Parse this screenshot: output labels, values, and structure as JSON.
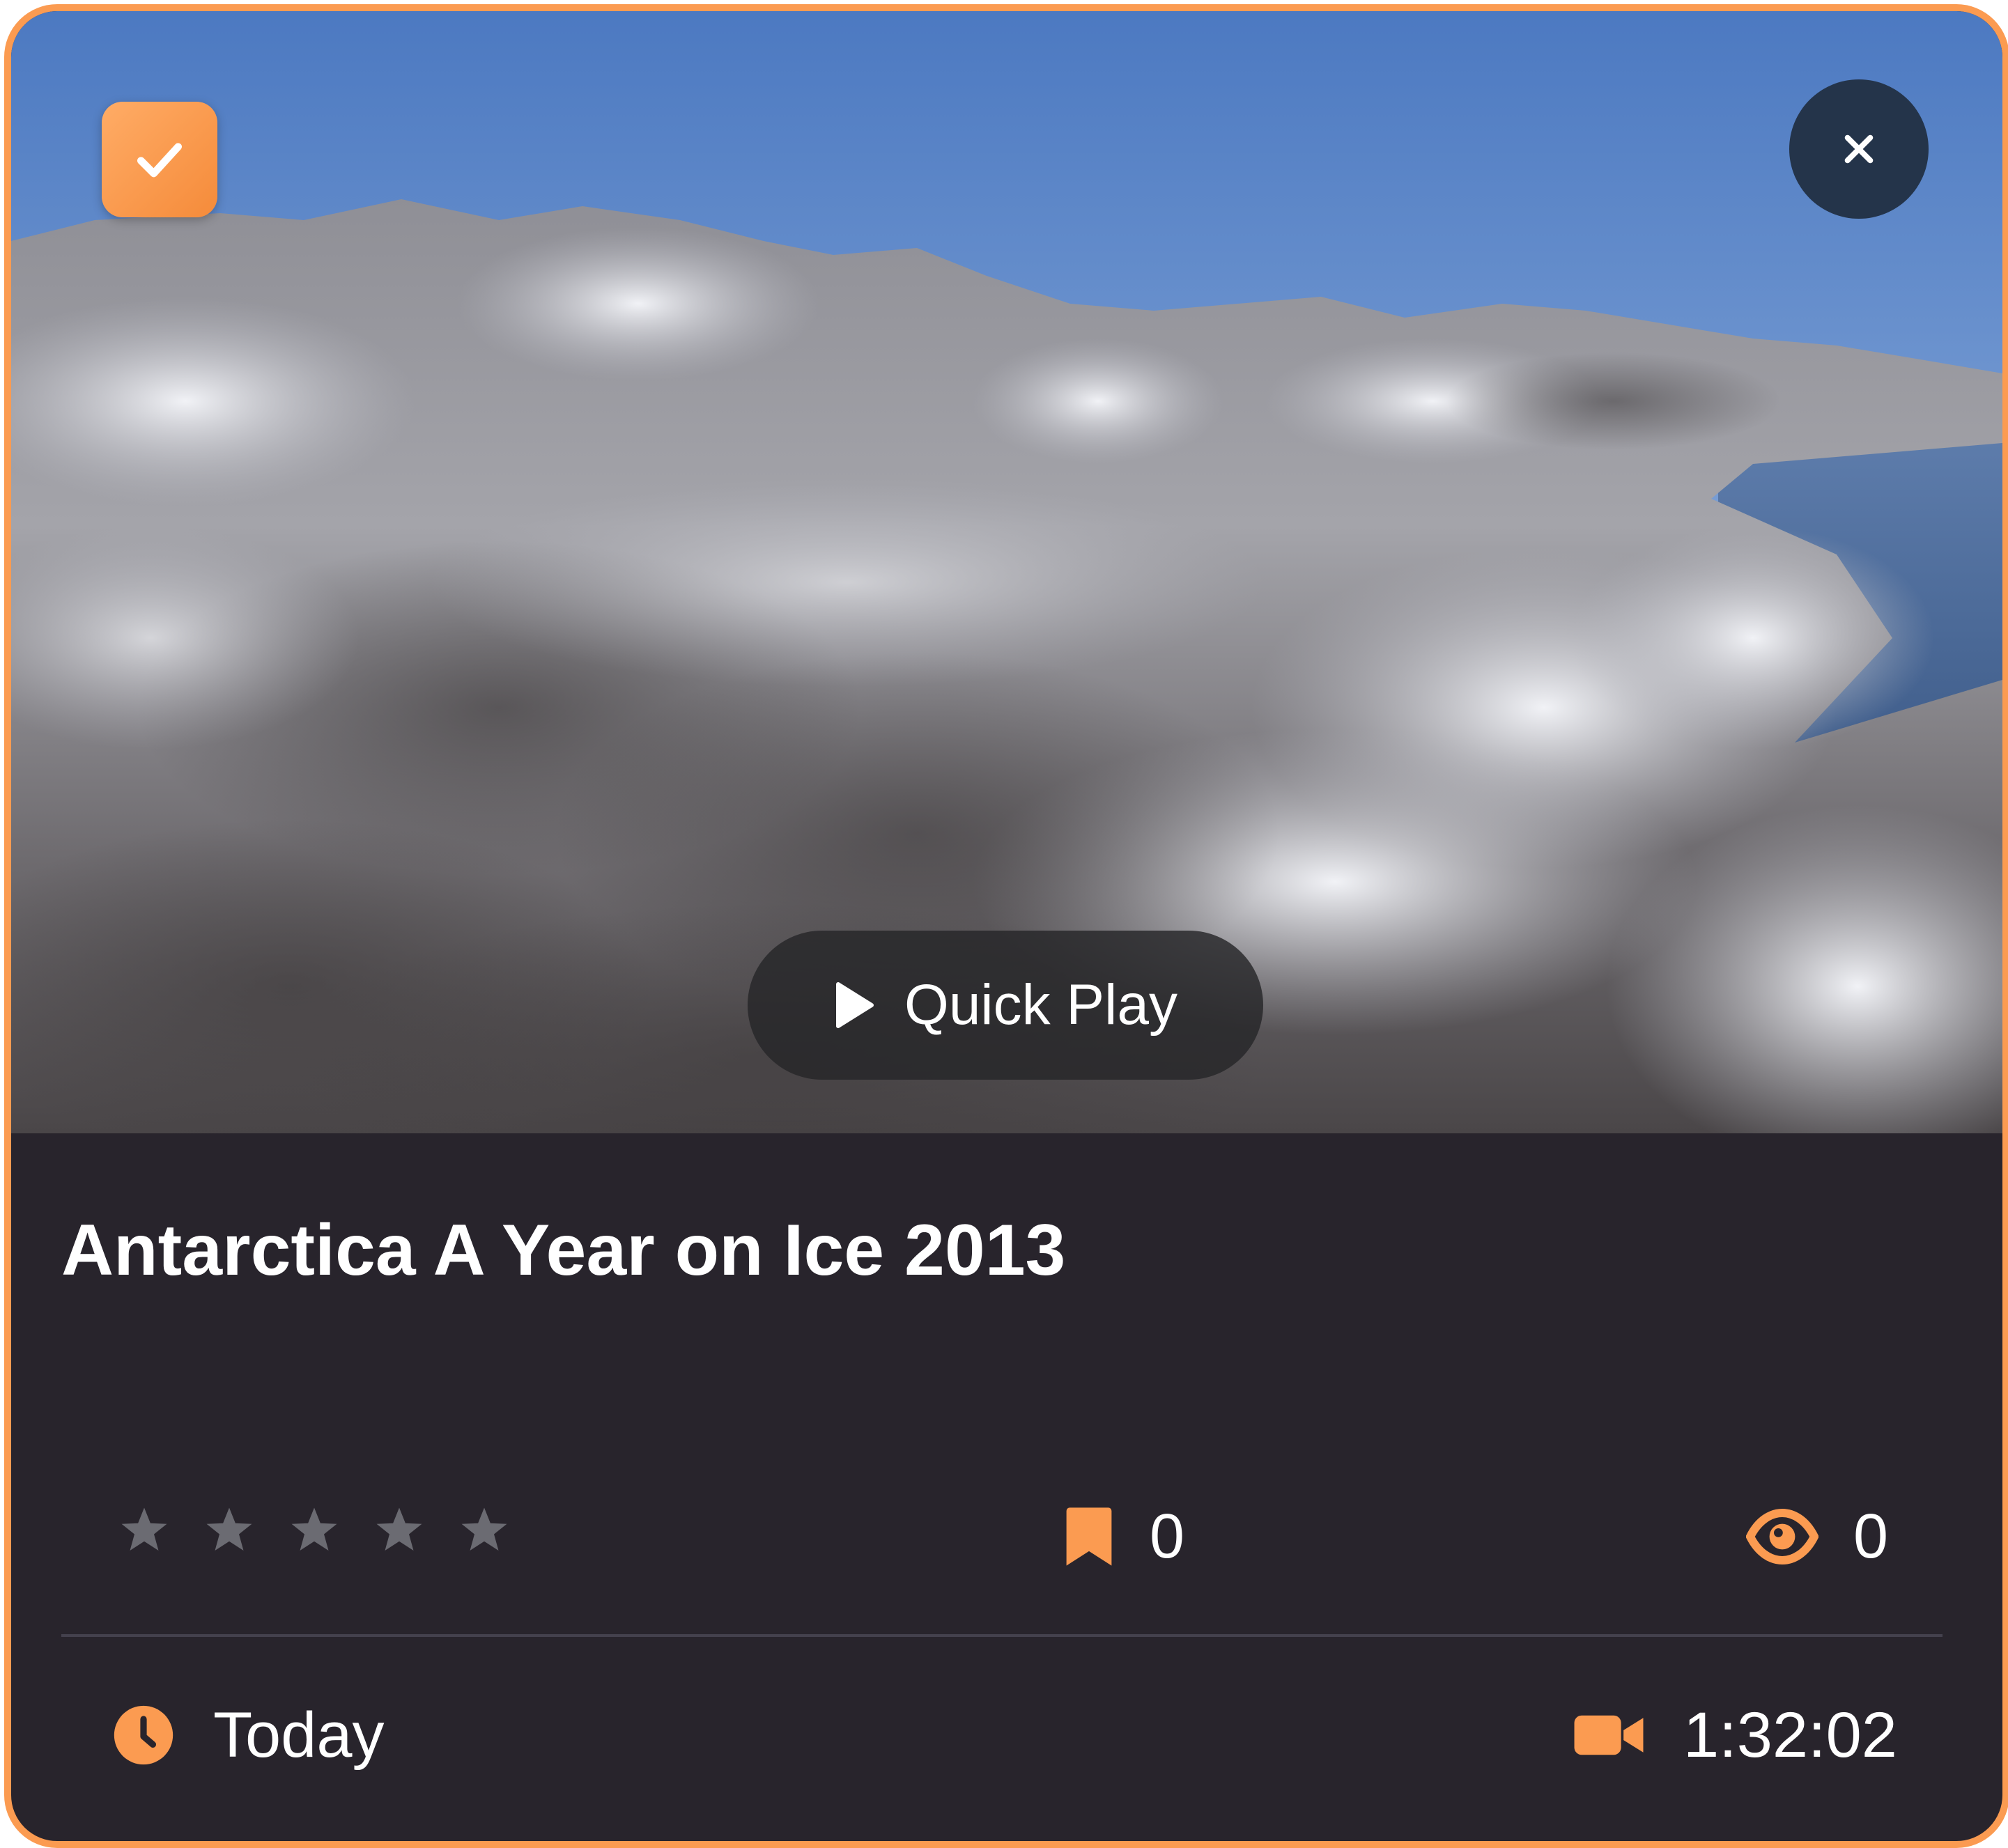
{
  "video": {
    "title": "Antarctica A Year on Ice 2013",
    "quick_play_label": "Quick Play",
    "rating_stars": 0,
    "rating_max": 5,
    "bookmarks_count": "0",
    "views_count": "0",
    "date_label": "Today",
    "duration": "1:32:02",
    "selected": true
  },
  "icons": {
    "select": "checkmark-icon",
    "close": "close-icon",
    "play": "play-icon",
    "star": "star-icon",
    "bookmark": "bookmark-icon",
    "eye": "eye-icon",
    "clock": "clock-icon",
    "camera": "video-camera-icon"
  },
  "colors": {
    "accent": "#fb9b51",
    "card_background": "#28242c",
    "close_button": "#24344a",
    "star_inactive": "#6b6b72",
    "text": "#ffffff"
  }
}
